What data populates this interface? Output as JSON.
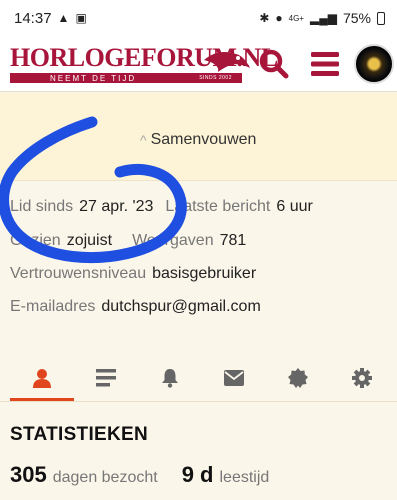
{
  "status": {
    "time": "14:37",
    "battery": "75%",
    "signal": "4G+"
  },
  "header": {
    "logo_title": "HORLOGEFORUM.NL",
    "logo_subtitle": "NEEMT DE TIJD",
    "logo_since": "SINDS 2002"
  },
  "profile": {
    "collapse_label": "Samenvouwen",
    "member_since_label": "Lid sinds",
    "member_since_value": "27 apr. '23",
    "last_post_label": "Laatste bericht",
    "last_post_value": "6 uur",
    "seen_label": "Gezien",
    "seen_value": "zojuist",
    "views_label": "Weergaven",
    "views_value": "781",
    "trust_label": "Vertrouwensniveau",
    "trust_value": "basisgebruiker",
    "email_label": "E-mailadres",
    "email_value": "dutchspur@gmail.com"
  },
  "tabs": [
    "profile-icon",
    "list-icon",
    "bell-icon",
    "mail-icon",
    "badge-icon",
    "gear-icon"
  ],
  "stats": {
    "title": "STATISTIEKEN",
    "days_value": "305",
    "days_label": "dagen bezocht",
    "read_value": "9 d",
    "read_label": "leestijd"
  },
  "colors": {
    "brand": "#a8153a",
    "accent": "#e0451d",
    "scribble": "#1f4fe0"
  }
}
